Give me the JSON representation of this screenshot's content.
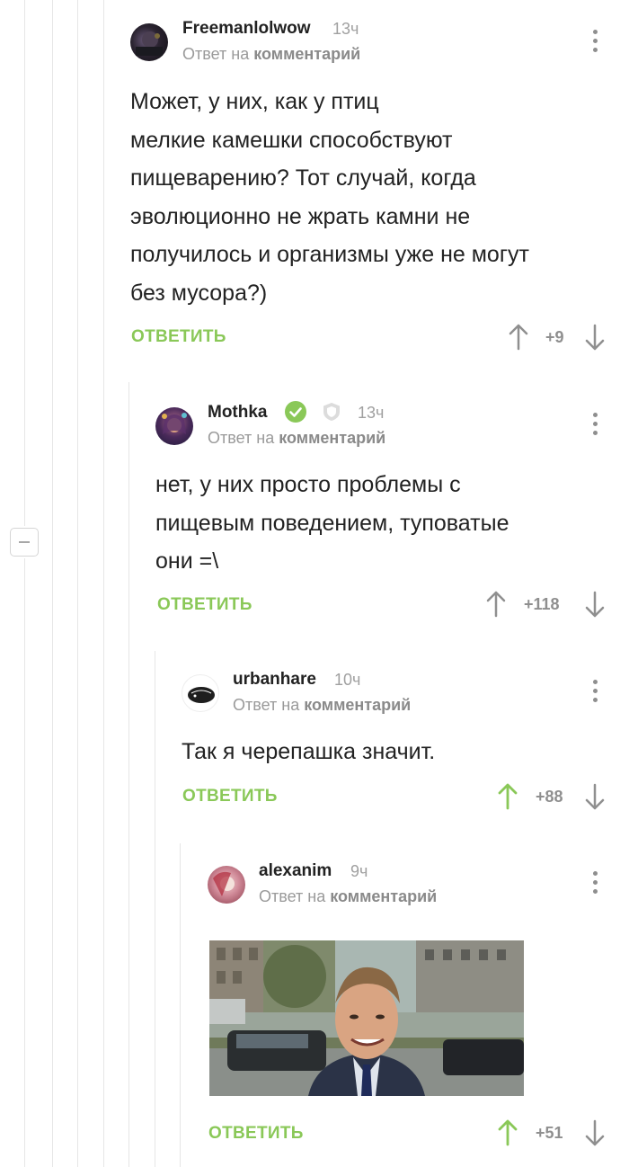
{
  "colors": {
    "accent": "#8ac858",
    "muted": "#a0a0a0",
    "text": "#222222",
    "line": "#e6e6e6"
  },
  "comments": [
    {
      "author": "Freemanlolwow",
      "time": "13ч",
      "reply_prefix": "Ответ на",
      "reply_target": "комментарий",
      "lines": [
        "Может, у них, как у птиц",
        "мелкие камешки способствуют",
        "пищеварению? Тот случай, когда",
        "эволюционно не жрать камни не",
        "получилось и организмы уже не могут",
        "без мусора?)"
      ],
      "reply_label": "ОТВЕТИТЬ",
      "score": "+9"
    },
    {
      "author": "Mothka",
      "time": "13ч",
      "reply_prefix": "Ответ на",
      "reply_target": "комментарий",
      "lines": [
        "нет, у них просто проблемы с",
        "пищевым поведением, туповатые",
        "они =\\"
      ],
      "reply_label": "ОТВЕТИТЬ",
      "score": "+118"
    },
    {
      "author": "urbanhare",
      "time": "10ч",
      "reply_prefix": "Ответ на",
      "reply_target": "комментарий",
      "lines": [
        "Так я черепашка значит."
      ],
      "reply_label": "ОТВЕТИТЬ",
      "score": "+88"
    },
    {
      "author": "alexanim",
      "time": "9ч",
      "reply_prefix": "Ответ на",
      "reply_target": "комментарий",
      "lines": [],
      "reply_label": "ОТВЕТИТЬ",
      "score": "+51"
    }
  ],
  "icons": {
    "menu": "kebab-menu-icon",
    "up": "arrow-up-icon",
    "down": "arrow-down-icon",
    "verified": "check-badge-icon",
    "shield": "shield-icon",
    "collapse": "minus-icon"
  }
}
